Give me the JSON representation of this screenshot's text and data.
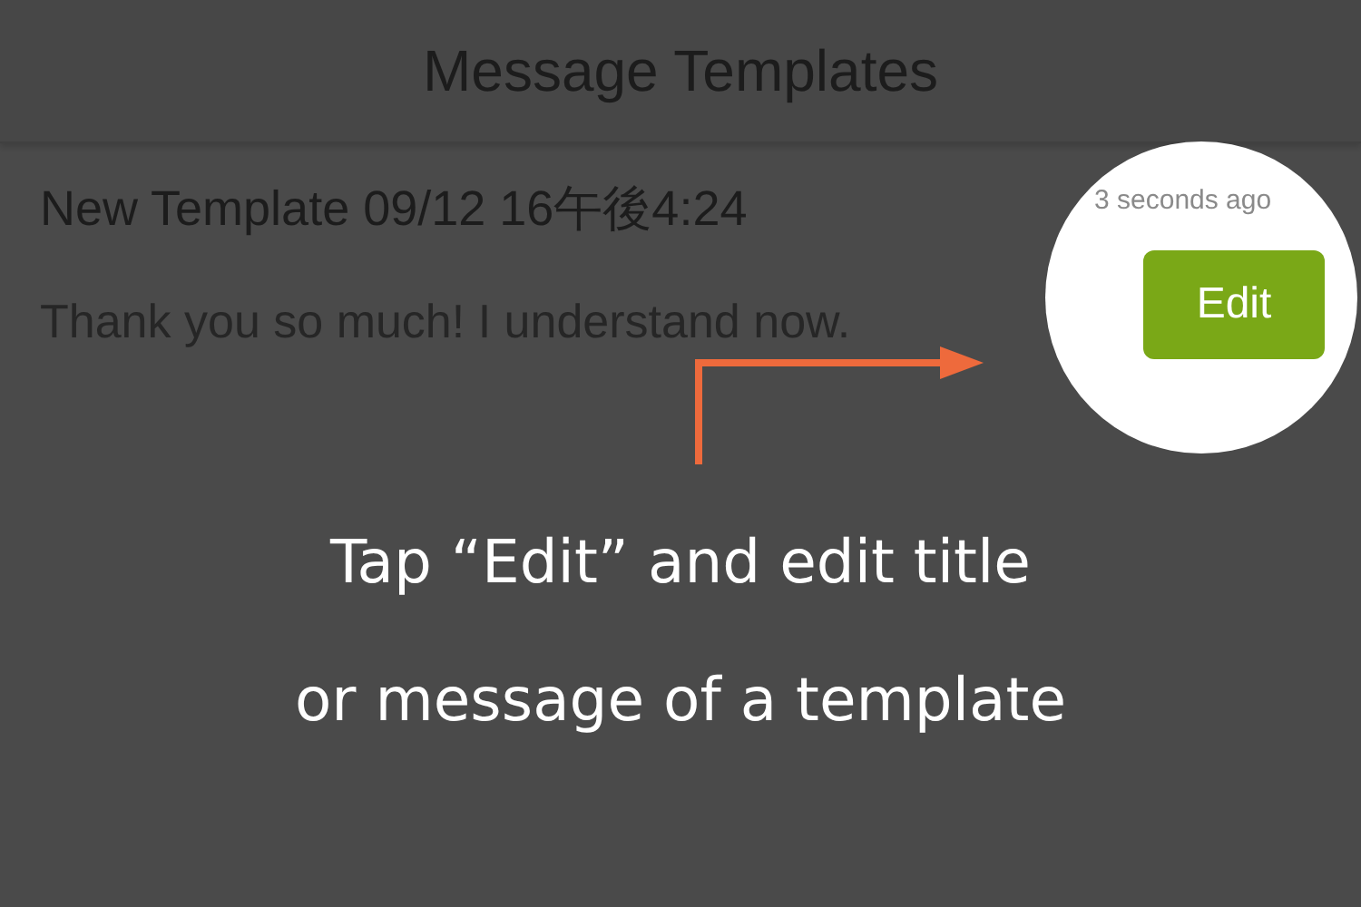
{
  "header": {
    "title": "Message Templates"
  },
  "template": {
    "title": "New Template 09/12 16午後4:24",
    "message": "Thank you so much! I understand now.",
    "time": "3 seconds ago",
    "edit_button": "Edit"
  },
  "caption": {
    "lines": [
      "Tap “Edit” and edit title",
      "or message of a template"
    ]
  }
}
